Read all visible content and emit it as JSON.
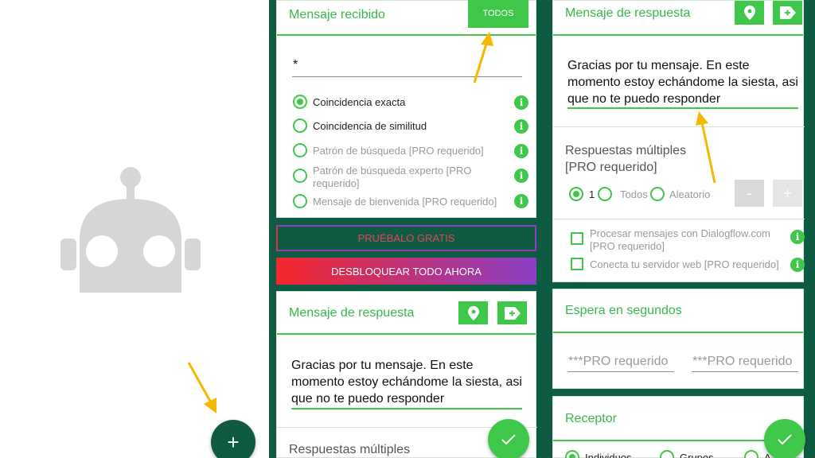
{
  "colors": {
    "accent": "#3ec748",
    "dark_green": "#0f5a42",
    "arrow": "#f5b800",
    "robot": "#d6d6d6"
  },
  "left": {
    "fab_label": "+"
  },
  "middle": {
    "received": {
      "title": "Mensaje recibido",
      "all_button": "TODOS",
      "input_value": "*",
      "options": [
        "Coincidencia exacta",
        "Coincidencia de similitud",
        "Patrón de búsqueda [PRO requerido]",
        "Patrón de búsqueda experto [PRO requerido]",
        "Mensaje de bienvenida [PRO requerido]"
      ]
    },
    "try_free": "PRUÉBALO GRATIS",
    "unlock_all": "DESBLOQUEAR TODO AHORA",
    "reply": {
      "title": "Mensaje de respuesta",
      "text": "Gracias por tu mensaje. En este momento estoy echándome la siesta, asi que no te puedo responder",
      "multiple_title": "Respuestas múltiples"
    }
  },
  "right": {
    "reply": {
      "title": "Mensaje de respuesta",
      "text": "Gracias por tu mensaje. En este momento estoy echándome la siesta, asi que no te puedo responder",
      "multiple_title": "Respuestas múltiples [PRO requerido]",
      "multi_options": [
        "1",
        "Todos",
        "Aleatorio"
      ],
      "minus": "-",
      "plus": "+",
      "checks": [
        "Procesar mensajes con Dialogflow.com [PRO requerido]",
        "Conecta tu servidor web [PRO requerido]"
      ]
    },
    "wait": {
      "title": "Espera en segundos",
      "field1": "***PRO requerido",
      "field2": "***PRO requerido"
    },
    "receiver": {
      "title": "Receptor",
      "options": [
        "Individuos",
        "Grupos",
        "A"
      ]
    }
  },
  "icons": {
    "fab": "check-icon",
    "location": "location-pin-icon",
    "tag": "label-icon",
    "info": "info-icon"
  }
}
